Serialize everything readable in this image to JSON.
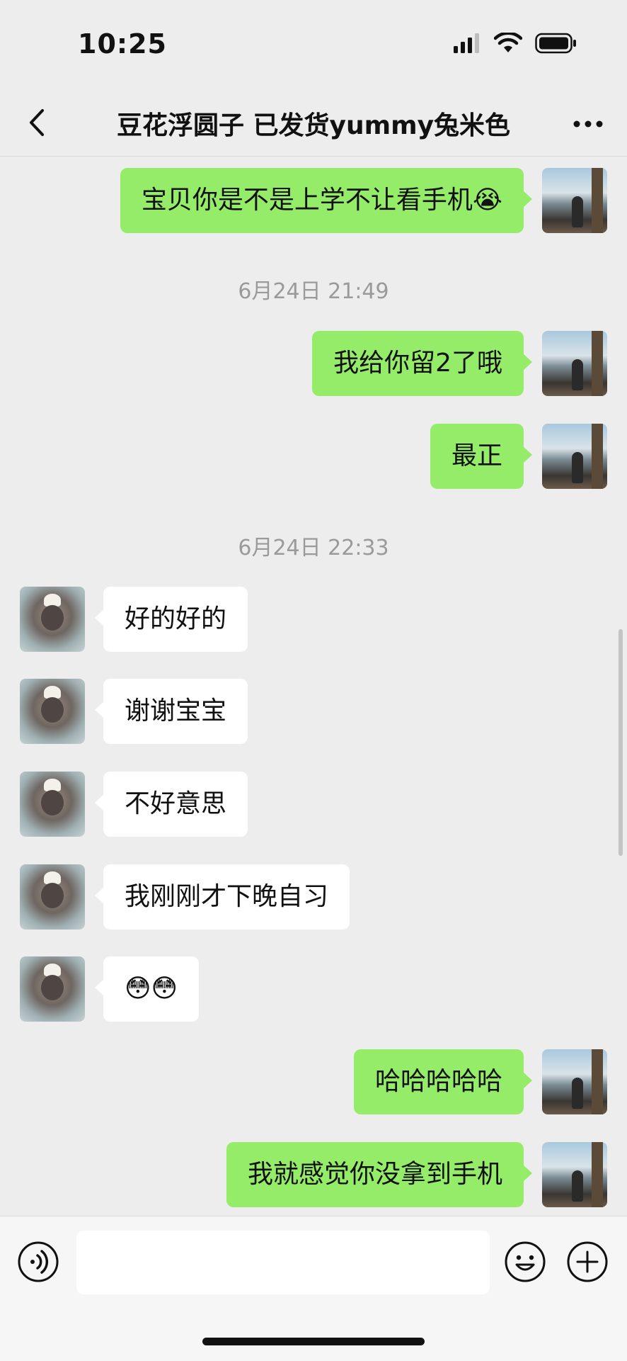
{
  "status_bar": {
    "time": "10:25"
  },
  "nav": {
    "title": "豆花浮圆子 已发货yummy兔米色"
  },
  "messages": [
    {
      "side": "me",
      "text": "宝贝你是不是上学不让看手机😭"
    },
    {
      "side": "me",
      "text": "我给你留2了哦"
    },
    {
      "side": "me",
      "text": "最正"
    },
    {
      "side": "them",
      "text": "好的好的"
    },
    {
      "side": "them",
      "text": "谢谢宝宝"
    },
    {
      "side": "them",
      "text": "不好意思"
    },
    {
      "side": "them",
      "text": "我刚刚才下晚自习"
    },
    {
      "side": "them",
      "text": "😳😳"
    },
    {
      "side": "me",
      "text": "哈哈哈哈哈"
    },
    {
      "side": "me",
      "text": "我就感觉你没拿到手机"
    }
  ],
  "timestamps": [
    "6月24日 21:49",
    "6月24日 22:33"
  ],
  "input": {
    "placeholder": ""
  }
}
